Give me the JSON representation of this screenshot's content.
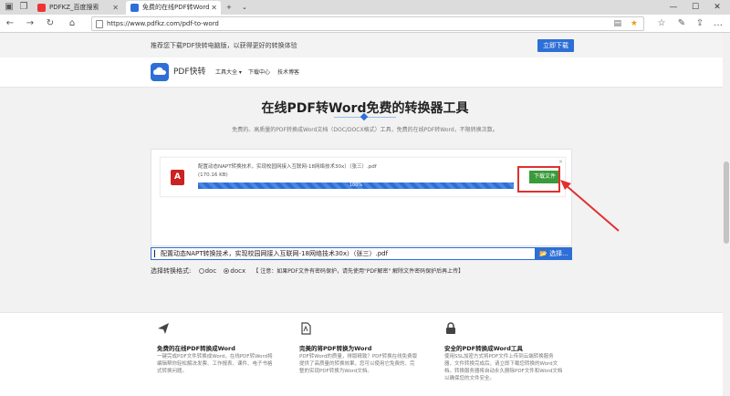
{
  "browser": {
    "tabs": [
      {
        "label": "PDFKZ_百度搜索",
        "active": false,
        "color": "#e33"
      },
      {
        "label": "免费的在线PDF转Word",
        "active": true,
        "color": "#2d6fd6"
      }
    ],
    "new_tab": "+",
    "url": "https://www.pdfkz.com/pdf-to-word",
    "window_buttons": [
      "—",
      "☐",
      "✕"
    ]
  },
  "promo": {
    "text": "推荐您下载PDF快转电脑版，以获得更好的转换体验",
    "button": "立即下载"
  },
  "site": {
    "logo": "PDF快转",
    "nav": [
      "工具大全 ▾",
      "下载中心",
      "技术博客"
    ]
  },
  "hero": {
    "title": "在线PDF转Word免费的转换器工具",
    "subtitle": "免费的、高质量的PDF转换成Word文档（DOC/DOCX格式）工具，免费的在线PDF转Word，不限转换次数。"
  },
  "upload": {
    "file_name": "配置动态NAPT转换技术，实现校园网接入互联网-18网络技术30x）（张三）.pdf",
    "file_size": "(170.16 KB)",
    "progress_percent": 100,
    "progress_label": "100%",
    "download_button": "下载文件",
    "close": "×",
    "pdf_icon_text": "A"
  },
  "path": {
    "value": "配置动态NAPT转换技术，实现校园网接入互联网-18网络技术30x）（张三）.pdf",
    "choose_button": "📂 选择..."
  },
  "format": {
    "label": "选择转换格式:",
    "options": [
      "doc",
      "docx"
    ],
    "selected": "docx",
    "note": "【 注意：如果PDF文件有密码保护，请先使用\"PDF解密\" 解除文件密码保护后再上传】"
  },
  "features": [
    {
      "icon": "paper-plane-icon",
      "title": "免费的在线PDF转换成Word",
      "desc": "一键完成PDF文件转换成Word，在线PDF转Word将编辑帮你轻松解决发票、工作报表、课件、电子书格式转换问题。"
    },
    {
      "icon": "pdf-document-icon",
      "title": "完美的将PDF转换为Word",
      "desc": "PDF转Word的质量，排版精致？PDF转换在线免费版提供了高质量的转换效果，您可以使用它免费的、完整的实现PDF转换为Word文档。"
    },
    {
      "icon": "lock-icon",
      "title": "安全的PDF转换成Word工具",
      "desc": "使用SSL加密方式将PDF文件上传到云端转换服务器，文件转换完成后，请立即下载您转换的Word文档。转换服务器将自动永久删除PDF文件和Word文档以确保您的文件安全。"
    }
  ],
  "colors": {
    "accent": "#2d6fd6",
    "download": "#3a9b3a",
    "highlight": "#e03030"
  }
}
